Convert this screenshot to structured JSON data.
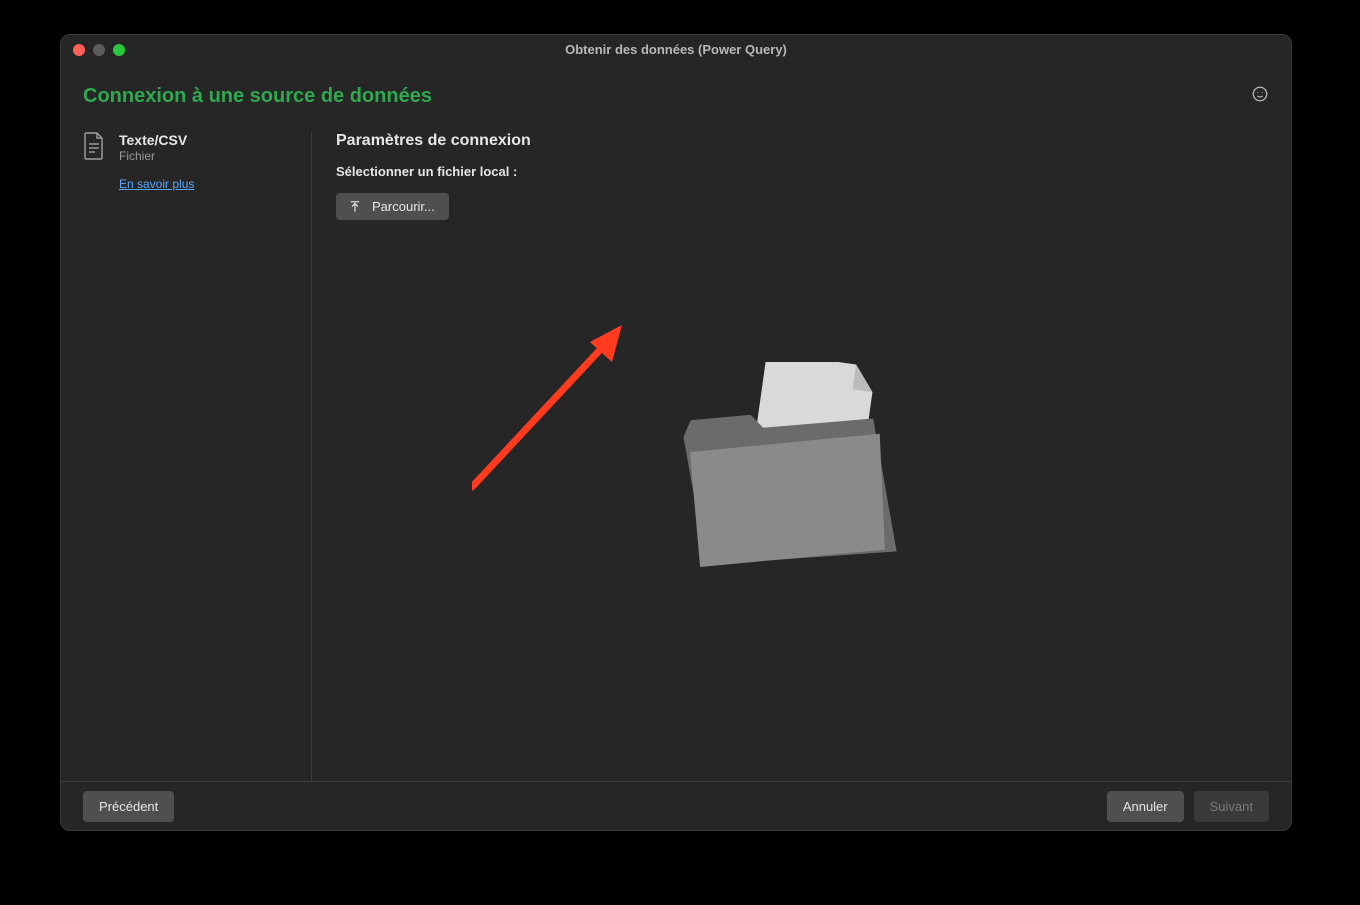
{
  "window": {
    "title": "Obtenir des données (Power Query)"
  },
  "page": {
    "title": "Connexion à une source de données"
  },
  "source": {
    "name": "Texte/CSV",
    "subtitle": "Fichier",
    "learn_more": "En savoir plus"
  },
  "params": {
    "title": "Paramètres de connexion",
    "select_label": "Sélectionner un fichier local :",
    "browse_label": "Parcourir..."
  },
  "footer": {
    "back": "Précédent",
    "cancel": "Annuler",
    "next": "Suivant"
  }
}
